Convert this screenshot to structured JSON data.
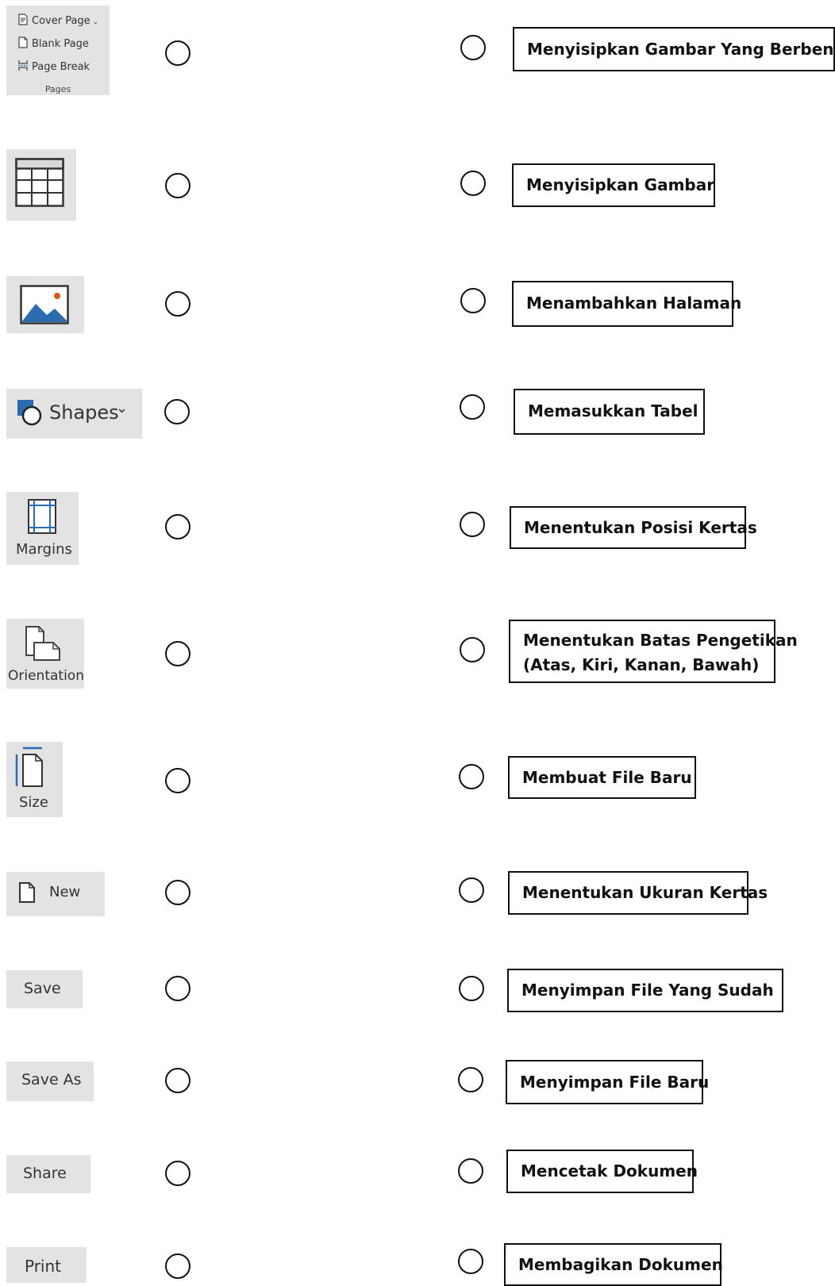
{
  "pages_group": {
    "cover_page": "Cover Page",
    "blank_page": "Blank Page",
    "page_break": "Page Break",
    "group_label": "Pages"
  },
  "tiles": {
    "shapes": "Shapes",
    "margins": "Margins",
    "orientation": "Orientation",
    "size": "Size",
    "new": "New",
    "save": "Save",
    "save_as": "Save As",
    "share": "Share",
    "print": "Print"
  },
  "answers": [
    "Menyisipkan Gambar Yang Berbentuk",
    "Menyisipkan Gambar",
    "Menambahkan Halaman",
    "Memasukkan Tabel",
    "Menentukan Posisi Kertas",
    "Menentukan Batas Pengetikan",
    "(Atas, Kiri, Kanan, Bawah)",
    "Membuat File Baru",
    "Menentukan Ukuran Kertas",
    "Menyimpan File Yang Sudah",
    "Menyimpan File Baru",
    "Mencetak Dokumen",
    "Membagikan Dokumen"
  ],
  "colors": {
    "tile_bg": "#e3e3e3",
    "accent_blue": "#2b6cb0",
    "accent_orange": "#e0531f"
  },
  "icons": [
    "cover-page-icon",
    "blank-page-icon",
    "page-break-icon",
    "table-icon",
    "picture-icon",
    "shapes-icon",
    "chevron-down-icon",
    "margins-icon",
    "orientation-icon",
    "size-icon",
    "new-document-icon"
  ]
}
